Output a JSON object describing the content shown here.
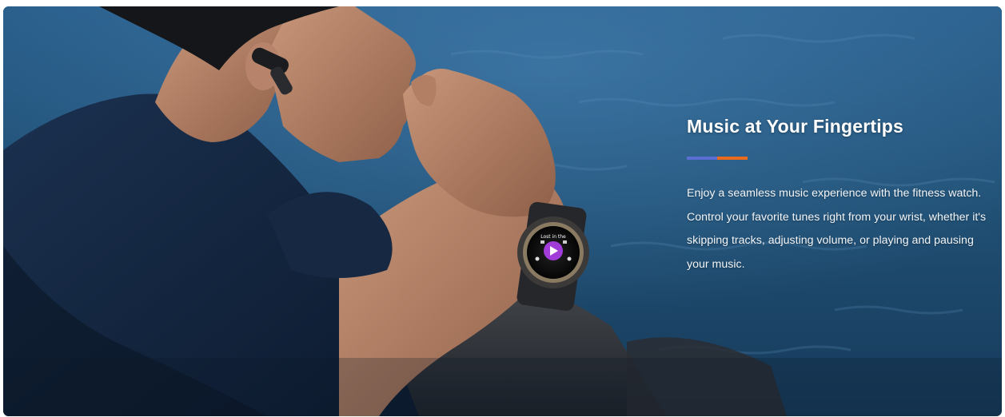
{
  "feature": {
    "title": "Music at Your Fingertips",
    "description": "Enjoy a seamless music experience with the fitness watch. Control your favorite tunes right from your wrist, whether it's skipping tracks, adjusting volume, or playing and pausing your music.",
    "accent_colors": [
      "#5a6dd2",
      "#ea6a1e"
    ]
  },
  "watch_screen": {
    "song_label": "Lost in the"
  }
}
